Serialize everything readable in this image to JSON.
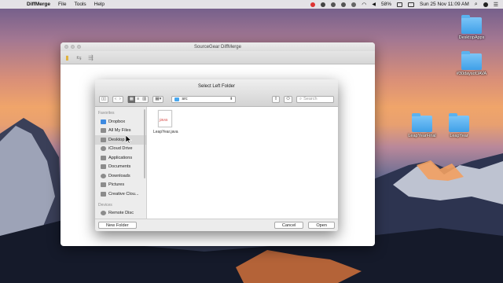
{
  "menubar": {
    "app": "DiffMerge",
    "menus": [
      "File",
      "Tools",
      "Help"
    ],
    "battery": "58%",
    "clock": "Sun 25 Nov  11:09 AM"
  },
  "desktop": {
    "icons": [
      {
        "label": "DesktopApps"
      },
      {
        "label": "#30daysofJAVA"
      },
      {
        "label": "LeapYearFinal"
      },
      {
        "label": "LeapYear"
      }
    ]
  },
  "diffmerge_window": {
    "title": "SourceGear DiffMerge"
  },
  "dialog": {
    "title": "Select Left Folder",
    "path_folder": "src",
    "search_placeholder": "Search",
    "sidebar": {
      "favorites_header": "Favorites",
      "favorites": [
        {
          "label": "Dropbox",
          "icon": "dropbox-icon"
        },
        {
          "label": "All My Files",
          "icon": "all-files-icon"
        },
        {
          "label": "Desktop",
          "icon": "desktop-icon",
          "selected": true
        },
        {
          "label": "iCloud Drive",
          "icon": "cloud-icon"
        },
        {
          "label": "Applications",
          "icon": "applications-icon"
        },
        {
          "label": "Documents",
          "icon": "documents-icon"
        },
        {
          "label": "Downloads",
          "icon": "downloads-icon"
        },
        {
          "label": "Pictures",
          "icon": "pictures-icon"
        },
        {
          "label": "Creative Clou...",
          "icon": "creative-cloud-icon"
        }
      ],
      "devices_header": "Devices",
      "devices": [
        {
          "label": "Remote Disc",
          "icon": "disc-icon"
        }
      ]
    },
    "file": {
      "name": "LeapYear.java",
      "badge": "java"
    },
    "buttons": {
      "new_folder": "New Folder",
      "cancel": "Cancel",
      "open": "Open"
    }
  },
  "colors": {
    "folder_blue": "#3fa0e8",
    "java_red": "#d9534f"
  }
}
